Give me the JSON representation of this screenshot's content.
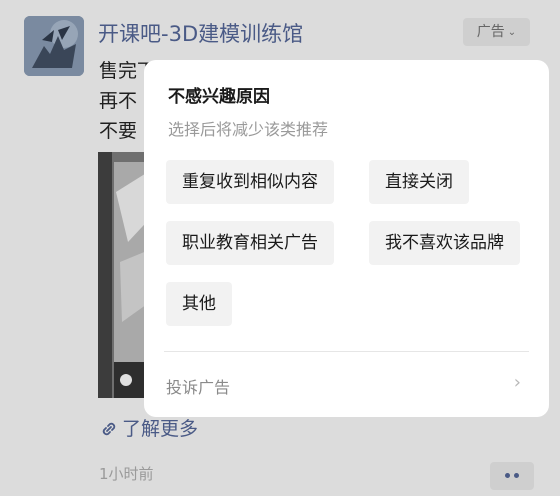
{
  "post": {
    "title": "开课吧-3D建模训练馆",
    "ad_label": "广告",
    "text_lines": [
      "售完下架",
      "再不",
      "不要"
    ],
    "learn_more": "了解更多",
    "time": "1小时前"
  },
  "popup": {
    "title": "不感兴趣原因",
    "subtitle": "选择后将减少该类推荐",
    "reasons": [
      "重复收到相似内容",
      "直接关闭",
      "职业教育相关广告",
      "我不喜欢该品牌",
      "其他"
    ],
    "complaint": "投诉广告"
  },
  "icons": {
    "ad_menu": "chevron-down-icon",
    "link": "link-icon",
    "complaint_arrow": "chevron-right-icon",
    "more": "more-dots-icon",
    "badge": "emoji-icon"
  },
  "colors": {
    "link_blue": "#4a5a86",
    "background": "#dcdcdc",
    "popup_bg": "#ffffff",
    "chip_bg": "#f2f2f2"
  }
}
